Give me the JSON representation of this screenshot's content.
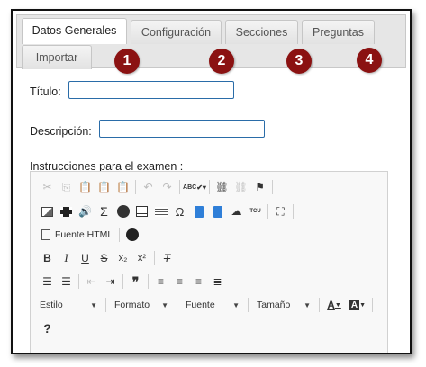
{
  "tabs": [
    {
      "label": "Datos Generales",
      "active": true
    },
    {
      "label": "Configuración",
      "active": false
    },
    {
      "label": "Secciones",
      "active": false
    },
    {
      "label": "Preguntas",
      "active": false
    },
    {
      "label": "Importar",
      "active": false
    }
  ],
  "badges": [
    "1",
    "2",
    "3",
    "4"
  ],
  "form": {
    "titulo_label": "Título:",
    "titulo_value": "",
    "descripcion_label": "Descripción:",
    "descripcion_value": "",
    "instrucciones_label": "Instrucciones para el examen :"
  },
  "editor": {
    "source_label": "Fuente HTML",
    "abc_label": "ABC",
    "tcu_label": "TCU",
    "subscript_label": "x₂",
    "superscript_label": "x²",
    "combos": {
      "style": "Estilo",
      "format": "Formato",
      "font": "Fuente",
      "size": "Tamaño"
    },
    "help_label": "?"
  },
  "colors": {
    "badge": "#8b1212",
    "input_border": "#2a6ca8",
    "tab_bar": "#e6e6e6"
  }
}
